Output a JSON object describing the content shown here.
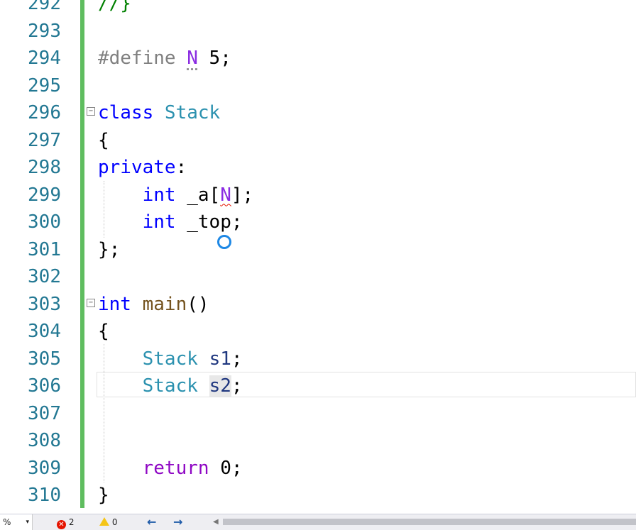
{
  "editor": {
    "lines": [
      {
        "num": "292",
        "tokens": [
          {
            "t": "//}",
            "c": "cm"
          }
        ]
      },
      {
        "num": "293",
        "tokens": []
      },
      {
        "num": "294",
        "tokens": [
          {
            "t": "#define ",
            "c": "pp"
          },
          {
            "t": "N",
            "c": "macro dots"
          },
          {
            "t": " 5;",
            "c": ""
          }
        ]
      },
      {
        "num": "295",
        "tokens": []
      },
      {
        "num": "296",
        "tokens": [
          {
            "t": "class ",
            "c": "kw"
          },
          {
            "t": "Stack",
            "c": "type"
          }
        ]
      },
      {
        "num": "297",
        "tokens": [
          {
            "t": "{",
            "c": ""
          }
        ]
      },
      {
        "num": "298",
        "tokens": [
          {
            "t": "private",
            "c": "kw"
          },
          {
            "t": ":",
            "c": ""
          }
        ]
      },
      {
        "num": "299",
        "tokens": [
          {
            "t": "    ",
            "c": ""
          },
          {
            "t": "int",
            "c": "kw"
          },
          {
            "t": " _a[",
            "c": ""
          },
          {
            "t": "N",
            "c": "macro squiggle"
          },
          {
            "t": "];",
            "c": ""
          }
        ]
      },
      {
        "num": "300",
        "tokens": [
          {
            "t": "    ",
            "c": ""
          },
          {
            "t": "int",
            "c": "kw"
          },
          {
            "t": " _top;",
            "c": ""
          }
        ]
      },
      {
        "num": "301",
        "tokens": [
          {
            "t": "};",
            "c": ""
          }
        ]
      },
      {
        "num": "302",
        "tokens": []
      },
      {
        "num": "303",
        "tokens": [
          {
            "t": "int",
            "c": "kw"
          },
          {
            "t": " ",
            "c": ""
          },
          {
            "t": "main",
            "c": "fn"
          },
          {
            "t": "()",
            "c": ""
          }
        ]
      },
      {
        "num": "304",
        "tokens": [
          {
            "t": "{",
            "c": ""
          }
        ]
      },
      {
        "num": "305",
        "tokens": [
          {
            "t": "    ",
            "c": ""
          },
          {
            "t": "Stack",
            "c": "type"
          },
          {
            "t": " ",
            "c": ""
          },
          {
            "t": "s1",
            "c": "var"
          },
          {
            "t": ";",
            "c": ""
          }
        ]
      },
      {
        "num": "306",
        "tokens": [
          {
            "t": "    ",
            "c": ""
          },
          {
            "t": "Stack",
            "c": "type"
          },
          {
            "t": " ",
            "c": ""
          },
          {
            "t": "s2",
            "c": "var hl"
          },
          {
            "t": ";",
            "c": ""
          }
        ]
      },
      {
        "num": "307",
        "tokens": []
      },
      {
        "num": "308",
        "tokens": []
      },
      {
        "num": "309",
        "tokens": [
          {
            "t": "    ",
            "c": ""
          },
          {
            "t": "return",
            "c": "flow"
          },
          {
            "t": " 0;",
            "c": ""
          }
        ]
      },
      {
        "num": "310",
        "tokens": [
          {
            "t": "}",
            "c": ""
          }
        ]
      }
    ]
  },
  "statusbar": {
    "zoom": "%",
    "errors": "2",
    "warnings": "0",
    "nav_back": "←",
    "nav_forward": "→"
  },
  "icons": {
    "error": "x-circle-icon",
    "warning": "warning-triangle-icon",
    "busy": "loading-spinner-icon"
  },
  "colors": {
    "line_number": "#237893",
    "keyword": "#0000ff",
    "type": "#2b91af",
    "macro": "#8a2be2",
    "change_bar": "#5fbd5f",
    "error": "#e51400"
  }
}
